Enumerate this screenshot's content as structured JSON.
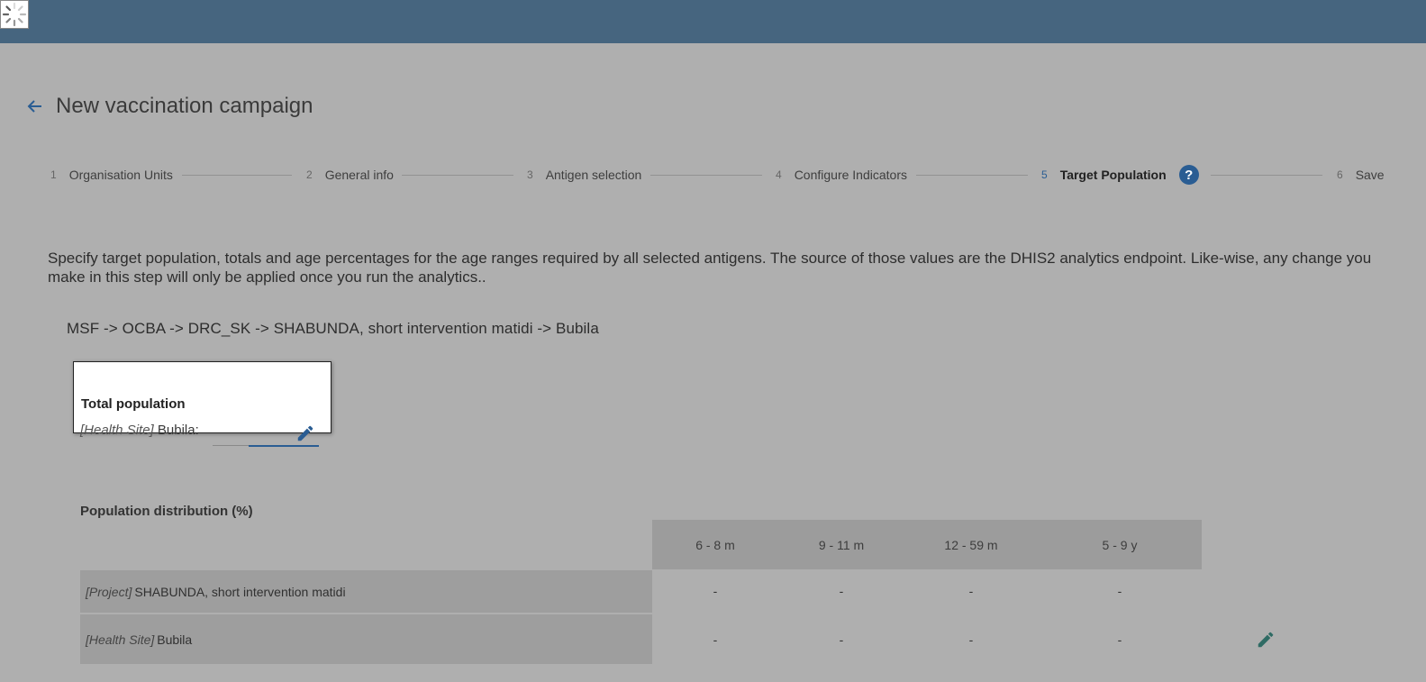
{
  "header": {
    "title": "New vaccination campaign",
    "back_icon": "arrow-left-icon",
    "loading_icon": "spinner-icon"
  },
  "colors": {
    "topbar": "#46657f",
    "accent": "#2a5d93",
    "edit_icon": "#2f6b64"
  },
  "stepper": {
    "steps": [
      {
        "number": "1",
        "label": "Organisation Units"
      },
      {
        "number": "2",
        "label": "General info"
      },
      {
        "number": "3",
        "label": "Antigen selection"
      },
      {
        "number": "4",
        "label": "Configure Indicators"
      },
      {
        "number": "5",
        "label": "Target Population",
        "active": true
      },
      {
        "number": "6",
        "label": "Save"
      }
    ],
    "help_label": "?"
  },
  "description": "Specify target population, totals and age percentages for the age ranges required by all selected antigens. The source of those values are the DHIS2 analytics endpoint. Like-wise, any change you make in this step will only be applied once you run the analytics..",
  "org_path": "MSF -> OCBA -> DRC_SK -> SHABUNDA, short intervention matidi -> Bubila",
  "total_population": {
    "title": "Total population",
    "tag": "[Health Site]",
    "name": "Bubila:"
  },
  "distribution": {
    "title": "Population distribution (%)",
    "columns": [
      "6 - 8 m",
      "9 - 11 m",
      "12 - 59 m",
      "5 - 9 y"
    ],
    "rows": [
      {
        "tag": "[Project]",
        "name": "SHABUNDA, short intervention matidi",
        "values": [
          "-",
          "-",
          "-",
          "-"
        ]
      },
      {
        "tag": "[Health Site]",
        "name": "Bubila",
        "values": [
          "-",
          "-",
          "-",
          "-"
        ],
        "editable": true
      }
    ]
  }
}
